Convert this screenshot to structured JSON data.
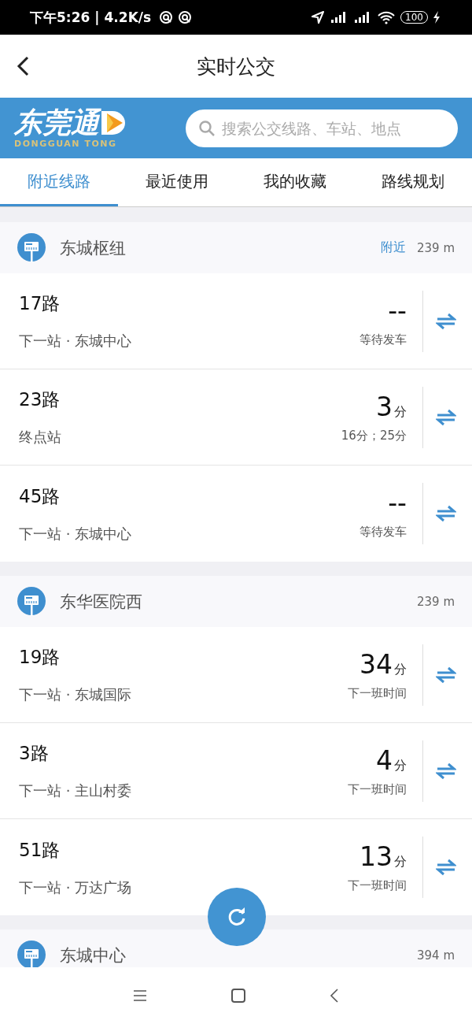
{
  "status_bar": {
    "time": "下午5:26",
    "separator": "|",
    "speed": "4.2K/s",
    "battery": "100"
  },
  "header": {
    "title": "实时公交"
  },
  "banner": {
    "logo_text": "东莞通",
    "logo_subtext": "DONGGUAN TONG",
    "search": {
      "placeholder": "搜索公交线路、车站、地点"
    }
  },
  "tabs": [
    {
      "label": "附近线路",
      "selected": true
    },
    {
      "label": "最近使用",
      "selected": false
    },
    {
      "label": "我的收藏",
      "selected": false
    },
    {
      "label": "路线规划",
      "selected": false
    }
  ],
  "stations": [
    {
      "name": "东城枢纽",
      "tag": "附近",
      "distance": "239 m",
      "routes": [
        {
          "route": "17路",
          "next": "下一站 · 东城中心",
          "time": "--",
          "status": "等待发车"
        },
        {
          "route": "23路",
          "next": "终点站",
          "time": "3",
          "unit": "分",
          "status": "16分；25分"
        },
        {
          "route": "45路",
          "next": "下一站 · 东城中心",
          "time": "--",
          "status": "等待发车"
        }
      ]
    },
    {
      "name": "东华医院西",
      "distance": "239 m",
      "routes": [
        {
          "route": "19路",
          "next": "下一站 · 东城国际",
          "time": "34",
          "unit": "分",
          "status": "下一班时间"
        },
        {
          "route": "3路",
          "next": "下一站 · 主山村委",
          "time": "4",
          "unit": "分",
          "status": "下一班时间"
        },
        {
          "route": "51路",
          "next": "下一站 · 万达广场",
          "time": "13",
          "unit": "分",
          "status": "下一班时间"
        }
      ]
    },
    {
      "name": "东城中心",
      "distance": "394 m"
    }
  ]
}
